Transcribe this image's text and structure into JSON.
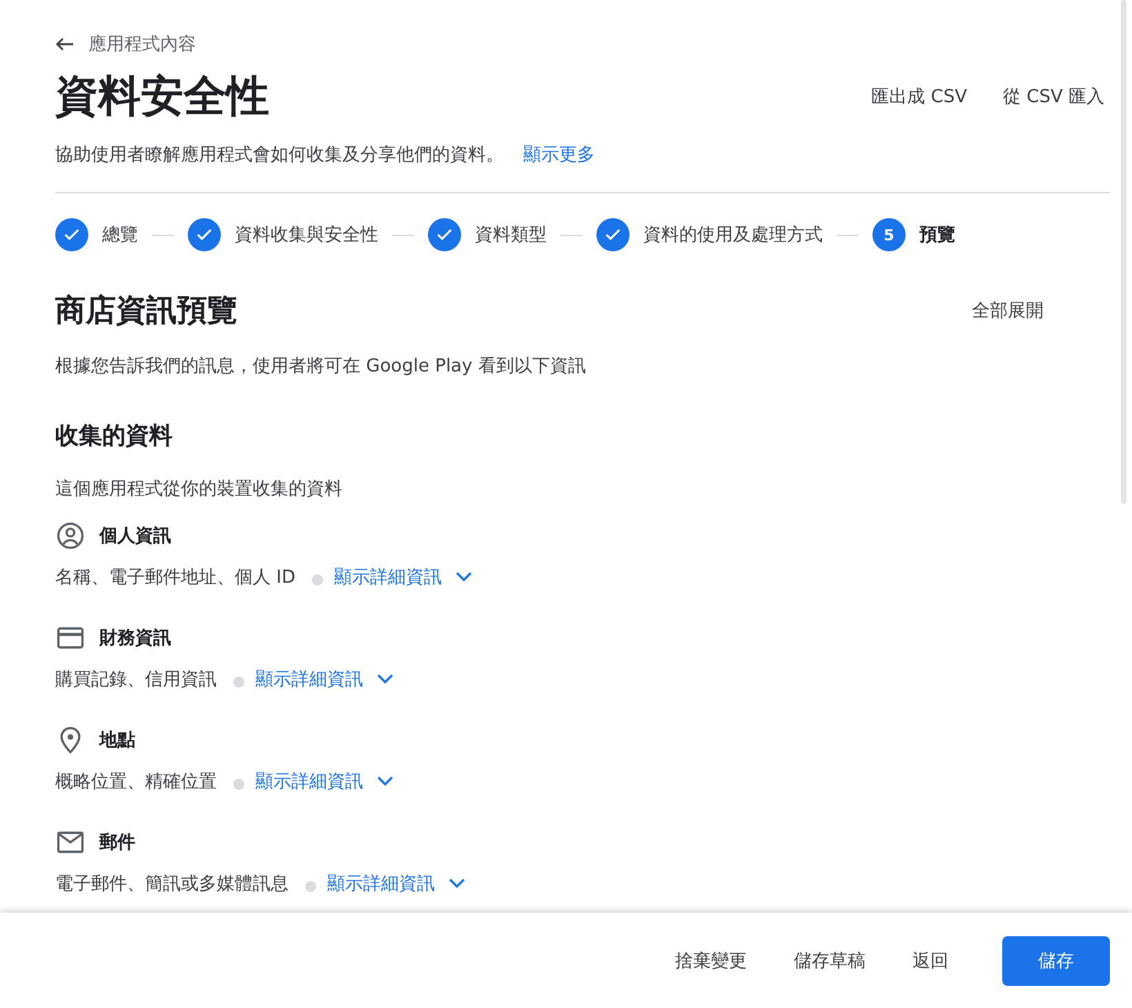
{
  "back_link": "應用程式內容",
  "title": "資料安全性",
  "header_actions": [
    "匯出成 CSV",
    "從 CSV 匯入"
  ],
  "subtitle": {
    "text": "協助使用者瞭解應用程式會如何收集及分享他們的資料。",
    "link": "顯示更多"
  },
  "steps": [
    {
      "label": "總覽",
      "completed": true,
      "selected": false
    },
    {
      "label": "資料收集與安全性",
      "completed": true,
      "selected": false
    },
    {
      "label": "資料類型",
      "completed": true,
      "selected": false
    },
    {
      "label": "資料的使用及處理方式",
      "completed": true,
      "selected": false
    },
    {
      "label": "預覽",
      "completed": false,
      "number": "5",
      "selected": true
    }
  ],
  "preview": {
    "title": "商店資訊預覽",
    "expand_all": "全部展開",
    "description": "根據您告訴我們的訊息，使用者將可在 Google Play 看到以下資訊"
  },
  "collected": {
    "title": "收集的資料",
    "description": "這個應用程式從你的裝置收集的資料",
    "categories": [
      {
        "kind": "person",
        "name": "個人資訊",
        "items": "名稱、電子郵件地址、個人 ID",
        "details": "顯示詳細資訊"
      },
      {
        "kind": "card",
        "name": "財務資訊",
        "items": "購買記錄、信用資訊",
        "details": "顯示詳細資訊"
      },
      {
        "kind": "location",
        "name": "地點",
        "items": "概略位置、精確位置",
        "details": "顯示詳細資訊"
      },
      {
        "kind": "mail",
        "name": "郵件",
        "items": "電子郵件、簡訊或多媒體訊息",
        "details": "顯示詳細資訊"
      }
    ]
  },
  "footer": {
    "buttons": [
      {
        "label": "捨棄變更",
        "primary": false
      },
      {
        "label": "儲存草稿",
        "primary": false
      },
      {
        "label": "返回",
        "primary": false
      },
      {
        "label": "儲存",
        "primary": true
      }
    ]
  }
}
